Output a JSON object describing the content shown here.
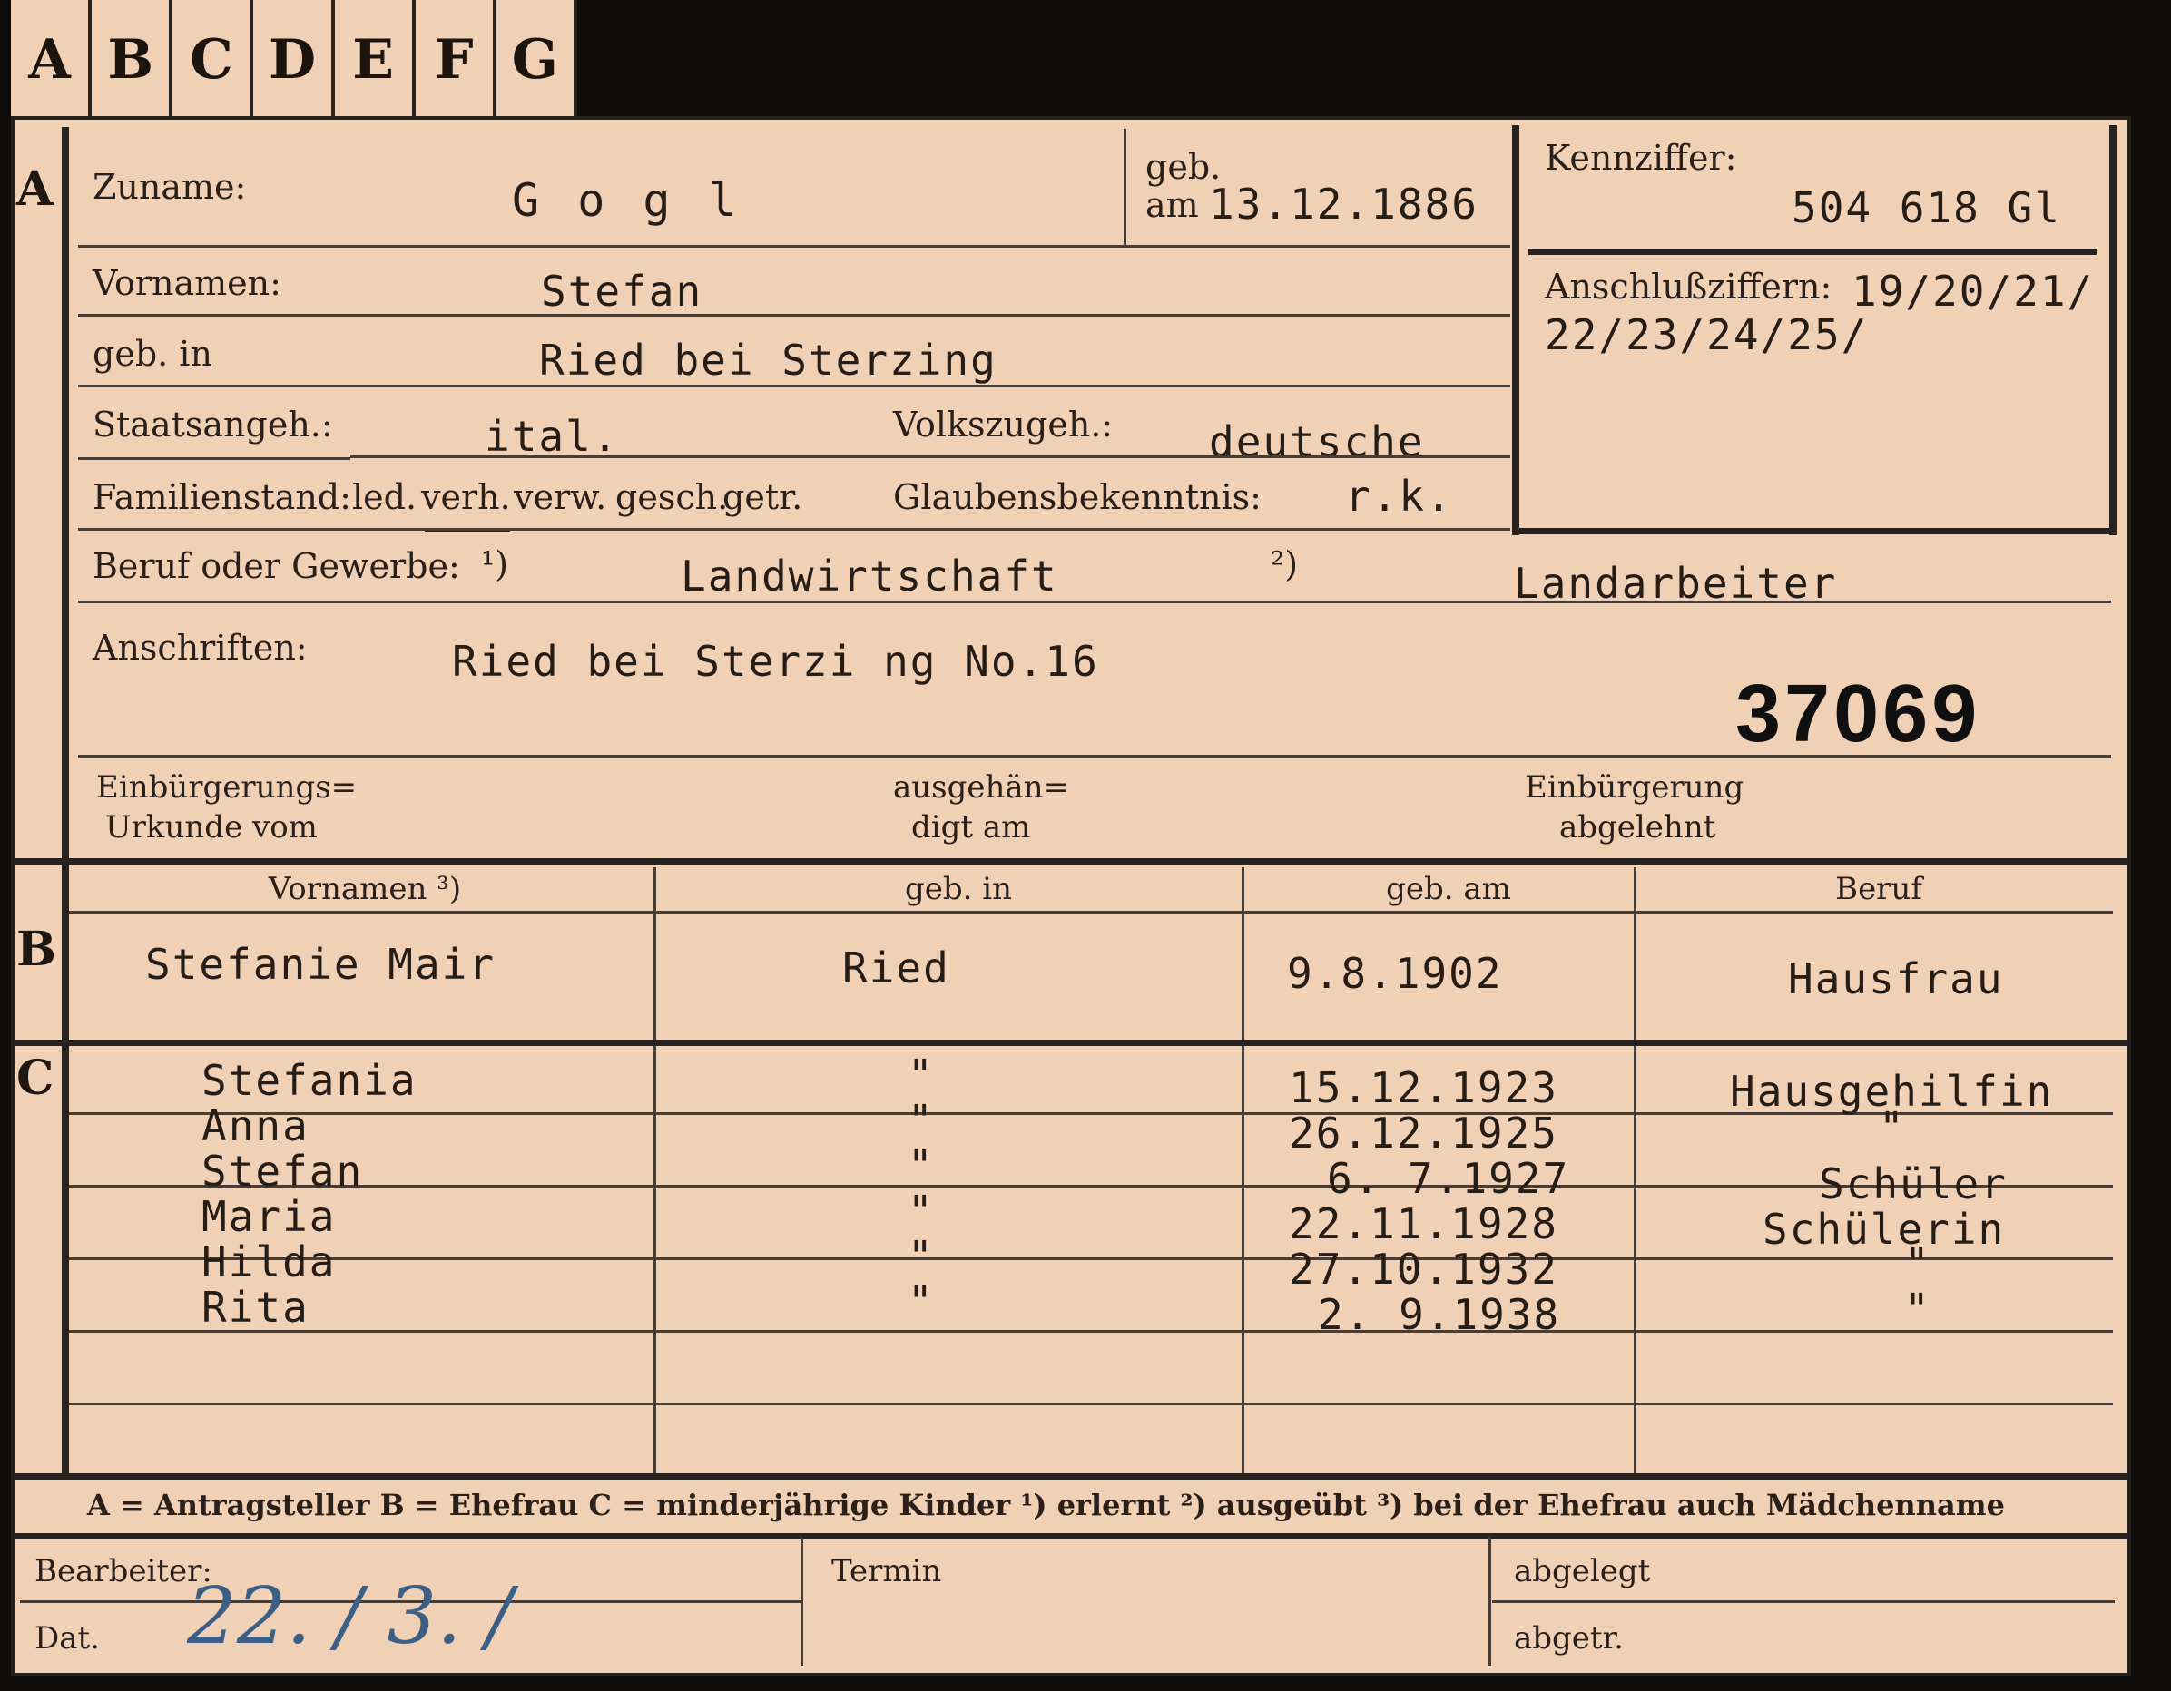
{
  "tabs": [
    "A",
    "B",
    "C",
    "D",
    "E",
    "F",
    "G"
  ],
  "sections": {
    "a": "A",
    "b": "B",
    "c": "C"
  },
  "a": {
    "zuname_label": "Zuname:",
    "zuname": "G o g l",
    "geb_label": "geb.",
    "am_label": "am",
    "geb_am": "13.12.1886",
    "kennziffer_label": "Kennziffer:",
    "kennziffer": "504 618   Gl",
    "anschluss_label": "Anschlußziffern:",
    "anschluss_1": "19/20/21/",
    "anschluss_2": "22/23/24/25/",
    "vornamen_label": "Vornamen:",
    "vornamen": "Stefan",
    "gebin_label": "geb. in",
    "gebin": "Ried bei Sterzing",
    "staat_label": "Staatsangeh.:",
    "staat": "ital.",
    "volk_label": "Volkszugeh.:",
    "volk": "deutsche",
    "familien_label": "Familienstand:",
    "familien_options": [
      "led.",
      "verh.",
      "verw.",
      "gesch.",
      "getr."
    ],
    "familien_selected": "verh.",
    "glauben_label": "Glaubensbekenntnis:",
    "glauben": "r.k.",
    "beruf_label": "Beruf oder Gewerbe:",
    "fn1": "¹)",
    "beruf_1": "Landwirtschaft",
    "fn2": "²)",
    "beruf_2": "Landarbeiter",
    "anschriften_label": "Anschriften:",
    "anschrift": "Ried bei Sterzi ng  No.16",
    "number": "37069",
    "einb_label_1": "Einbürgerungs=",
    "einb_label_2": "Urkunde vom",
    "ausg_label_1": "ausgehän=",
    "ausg_label_2": "digt am",
    "abgel_label_1": "Einbürgerung",
    "abgel_label_2": "abgelehnt"
  },
  "b": {
    "headers": [
      "Vornamen ³)",
      "geb. in",
      "geb. am",
      "Beruf"
    ],
    "row": {
      "name": "Stefanie Mair",
      "place": "Ried",
      "date": "9.8.1902",
      "job": "Hausfrau"
    }
  },
  "c": {
    "children": [
      {
        "name": "Stefania",
        "place": "\"",
        "date": "15.12.1923",
        "job": "Hausgehilfin"
      },
      {
        "name": "Anna",
        "place": "\"",
        "date": "26.12.1925",
        "job": "\""
      },
      {
        "name": "Stefan",
        "place": "\"",
        "date": "6. 7.1927",
        "job": "Schüler"
      },
      {
        "name": "Maria",
        "place": "\"",
        "date": "22.11.1928",
        "job": "Schülerin"
      },
      {
        "name": "Hilda",
        "place": "\"",
        "date": "27.10.1932",
        "job": "\""
      },
      {
        "name": "Rita",
        "place": "\"",
        "date": "2. 9.1938",
        "job": "\""
      }
    ]
  },
  "legend": "A = Antragsteller   B = Ehefrau   C = minderjährige Kinder   ¹) erlernt   ²) ausgeübt   ³) bei der Ehefrau auch Mädchenname",
  "footer": {
    "bearbeiter_label": "Bearbeiter:",
    "dat_label": "Dat.",
    "dat_value": "22. / 3. /",
    "termin_label": "Termin",
    "abgelegt_label": "abgelegt",
    "abgetr_label": "abgetr."
  }
}
